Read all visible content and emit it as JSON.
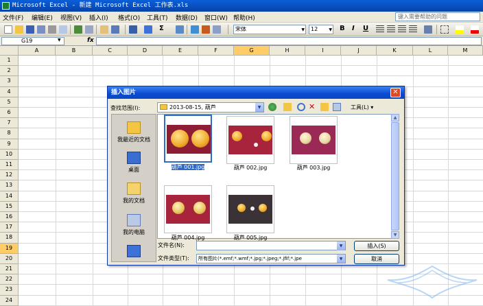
{
  "window": {
    "title": "Microsoft Excel - 新建 Microsoft Excel 工作表.xls"
  },
  "menubar": {
    "items": [
      "文件(F)",
      "编辑(E)",
      "视图(V)",
      "插入(I)",
      "格式(O)",
      "工具(T)",
      "数据(D)",
      "窗口(W)",
      "帮助(H)"
    ],
    "help_placeholder": "键入需要帮助的问题"
  },
  "toolbar": {
    "font": "宋体",
    "size": "12",
    "bold": "B",
    "italic": "I",
    "underline": "U",
    "sigma": "Σ"
  },
  "formulabar": {
    "namebox": "G19",
    "fx": "fx",
    "value": ""
  },
  "grid": {
    "columns": [
      "A",
      "B",
      "C",
      "D",
      "E",
      "F",
      "G",
      "H",
      "I",
      "J",
      "K",
      "L",
      "M"
    ],
    "rows": [
      "1",
      "2",
      "3",
      "4",
      "5",
      "6",
      "7",
      "8",
      "9",
      "10",
      "11",
      "12",
      "13",
      "14",
      "15",
      "16",
      "17",
      "18",
      "19",
      "20",
      "21",
      "22",
      "23",
      "24"
    ],
    "selected_column": "G",
    "selected_row": "19"
  },
  "dialog": {
    "title": "插入图片",
    "close": "✕",
    "lookin_label": "查找范围(I):",
    "lookin_value": "2013-08-15, 葫芦",
    "tools_label": "工具(L) ▾",
    "places": [
      {
        "label": "我最近的文档",
        "icon": "recent-documents-icon"
      },
      {
        "label": "桌面",
        "icon": "desktop-icon"
      },
      {
        "label": "我的文档",
        "icon": "my-documents-icon"
      },
      {
        "label": "我的电脑",
        "icon": "my-computer-icon"
      },
      {
        "label": "",
        "icon": "network-places-icon"
      }
    ],
    "files": [
      {
        "name": "葫芦 001.jpg",
        "selected": true
      },
      {
        "name": "葫芦 002.jpg",
        "selected": false
      },
      {
        "name": "葫芦 003.jpg",
        "selected": false
      },
      {
        "name": "葫芦 004.jpg",
        "selected": false
      },
      {
        "name": "葫芦 005.jpg",
        "selected": false
      }
    ],
    "filename_label": "文件名(N):",
    "filename_value": "",
    "filetype_label": "文件类型(T):",
    "filetype_value": "所有图片(*.emf;*.wmf;*.jpg;*.jpeg;*.jfif;*.jpe",
    "insert_button": "插入(S)",
    "cancel_button": "取消"
  },
  "colors": {
    "title_blue": "#0a5fd8",
    "selected_header": "#ffcc66",
    "selection_blue": "#316ac5"
  }
}
